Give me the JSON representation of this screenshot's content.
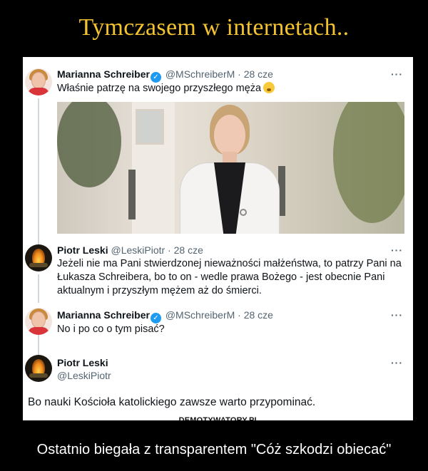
{
  "headline": "Tymczasem w internetach..",
  "tweets": [
    {
      "name": "Marianna Schreiber",
      "verified": true,
      "meta": "@MSchreiberM · 28 cze",
      "text": "Właśnie patrzę na swojego przyszłego męża",
      "emoji": "hushed-face-emoji",
      "has_photo": true
    },
    {
      "name": "Piotr Leski",
      "verified": false,
      "meta": "@LeskiPiotr · 28 cze",
      "text_lines": [
        "Jeżeli nie ma Pani stwierdzonej nieważności małżeństwa, to patrzy Pani na",
        "Łukasza Schreibera, bo to on - wedle prawa Bożego - jest obecnie Pani",
        "aktualnym i przyszłym mężem aż do śmierci."
      ]
    },
    {
      "name": "Marianna Schreiber",
      "verified": true,
      "meta": "@MSchreiberM · 28 cze",
      "text": "No i po co o tym pisać?"
    },
    {
      "name": "Piotr Leski",
      "handle": "@LeskiPiotr",
      "text": "Bo nauki Kościoła katolickiego zawsze warto przypominać."
    }
  ],
  "more_label": "···",
  "watermark": "DEMOTYWATORY.PL",
  "caption": "Ostatnio biegała z transparentem \"Cóż szkodzi obiecać\"",
  "colors": {
    "headline": "#f4c430",
    "background": "#000000",
    "verified": "#1d9bf0"
  }
}
